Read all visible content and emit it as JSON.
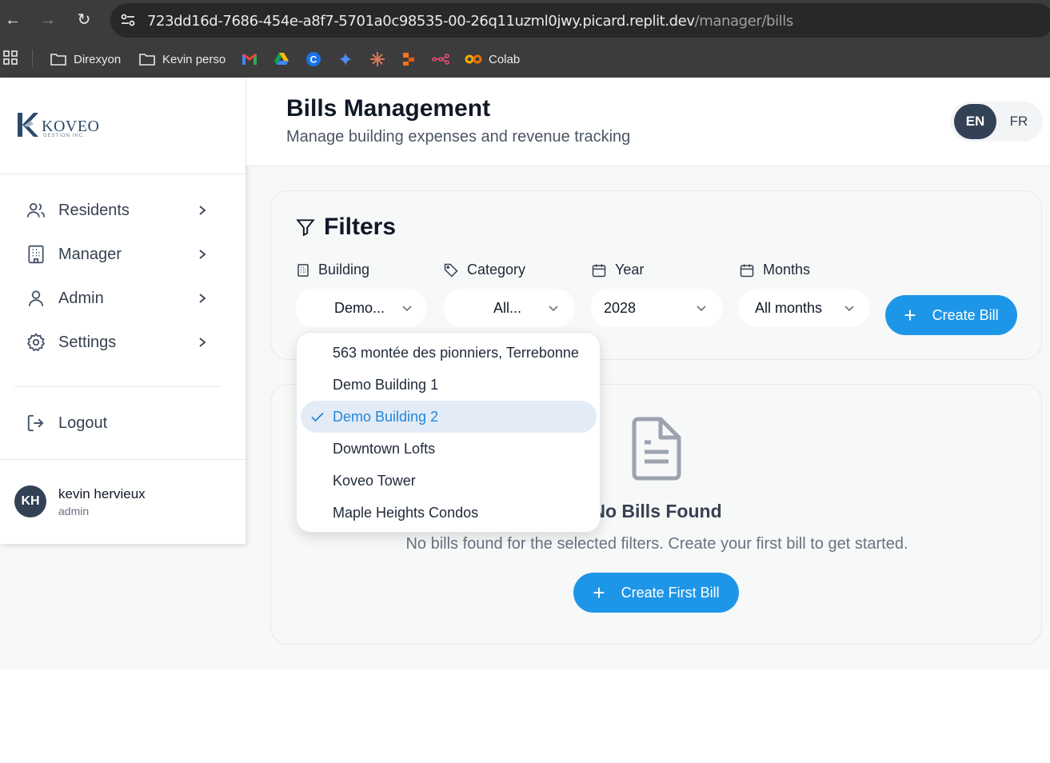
{
  "browser": {
    "url_host": "723dd16d-7686-454e-a8f7-5701a0c98535-00-26q11uzml0jwy.picard.replit.dev",
    "url_path": "/manager/bills",
    "bookmarks": [
      {
        "label": "Direxyon",
        "icon": "folder-icon"
      },
      {
        "label": "Kevin perso",
        "icon": "folder-icon"
      },
      {
        "label": "",
        "icon": "gmail-icon"
      },
      {
        "label": "",
        "icon": "drive-icon"
      },
      {
        "label": "",
        "icon": "c-app-icon"
      },
      {
        "label": "",
        "icon": "gemini-icon"
      },
      {
        "label": "",
        "icon": "claude-icon"
      },
      {
        "label": "",
        "icon": "figma-like-icon"
      },
      {
        "label": "",
        "icon": "n8n-icon"
      },
      {
        "label": "Colab",
        "icon": "colab-icon"
      }
    ]
  },
  "logo": {
    "word": "KOVEO",
    "sub": "GESTION INC."
  },
  "sidebar": {
    "items": [
      {
        "label": "Residents",
        "icon": "users-icon"
      },
      {
        "label": "Manager",
        "icon": "building-icon"
      },
      {
        "label": "Admin",
        "icon": "user-icon"
      },
      {
        "label": "Settings",
        "icon": "gear-icon"
      }
    ],
    "logout_label": "Logout",
    "user": {
      "initials": "KH",
      "name": "kevin hervieux",
      "role": "admin"
    }
  },
  "header": {
    "title": "Bills Management",
    "subtitle": "Manage building expenses and revenue tracking",
    "lang_en": "EN",
    "lang_fr": "FR"
  },
  "filters": {
    "title": "Filters",
    "building_label": "Building",
    "building_value": "Demo...",
    "category_label": "Category",
    "category_value": "All...",
    "year_label": "Year",
    "year_value": "2028",
    "months_label": "Months",
    "months_value": "All months",
    "create_bill_label": "Create Bill"
  },
  "building_dropdown": {
    "options": [
      "563 montée des pionniers, Terrebonne",
      "Demo Building 1",
      "Demo Building 2",
      "Downtown Lofts",
      "Koveo Tower",
      "Maple Heights Condos"
    ],
    "selected": "Demo Building 2"
  },
  "empty_state": {
    "title": "No Bills Found",
    "description": "No bills found for the selected filters. Create your first bill to get started.",
    "button_label": "Create First Bill"
  },
  "colors": {
    "primary": "#1e96e8",
    "logout": "#dc2626",
    "avatar": "#334155",
    "selected_bg": "#e3ebf6"
  }
}
